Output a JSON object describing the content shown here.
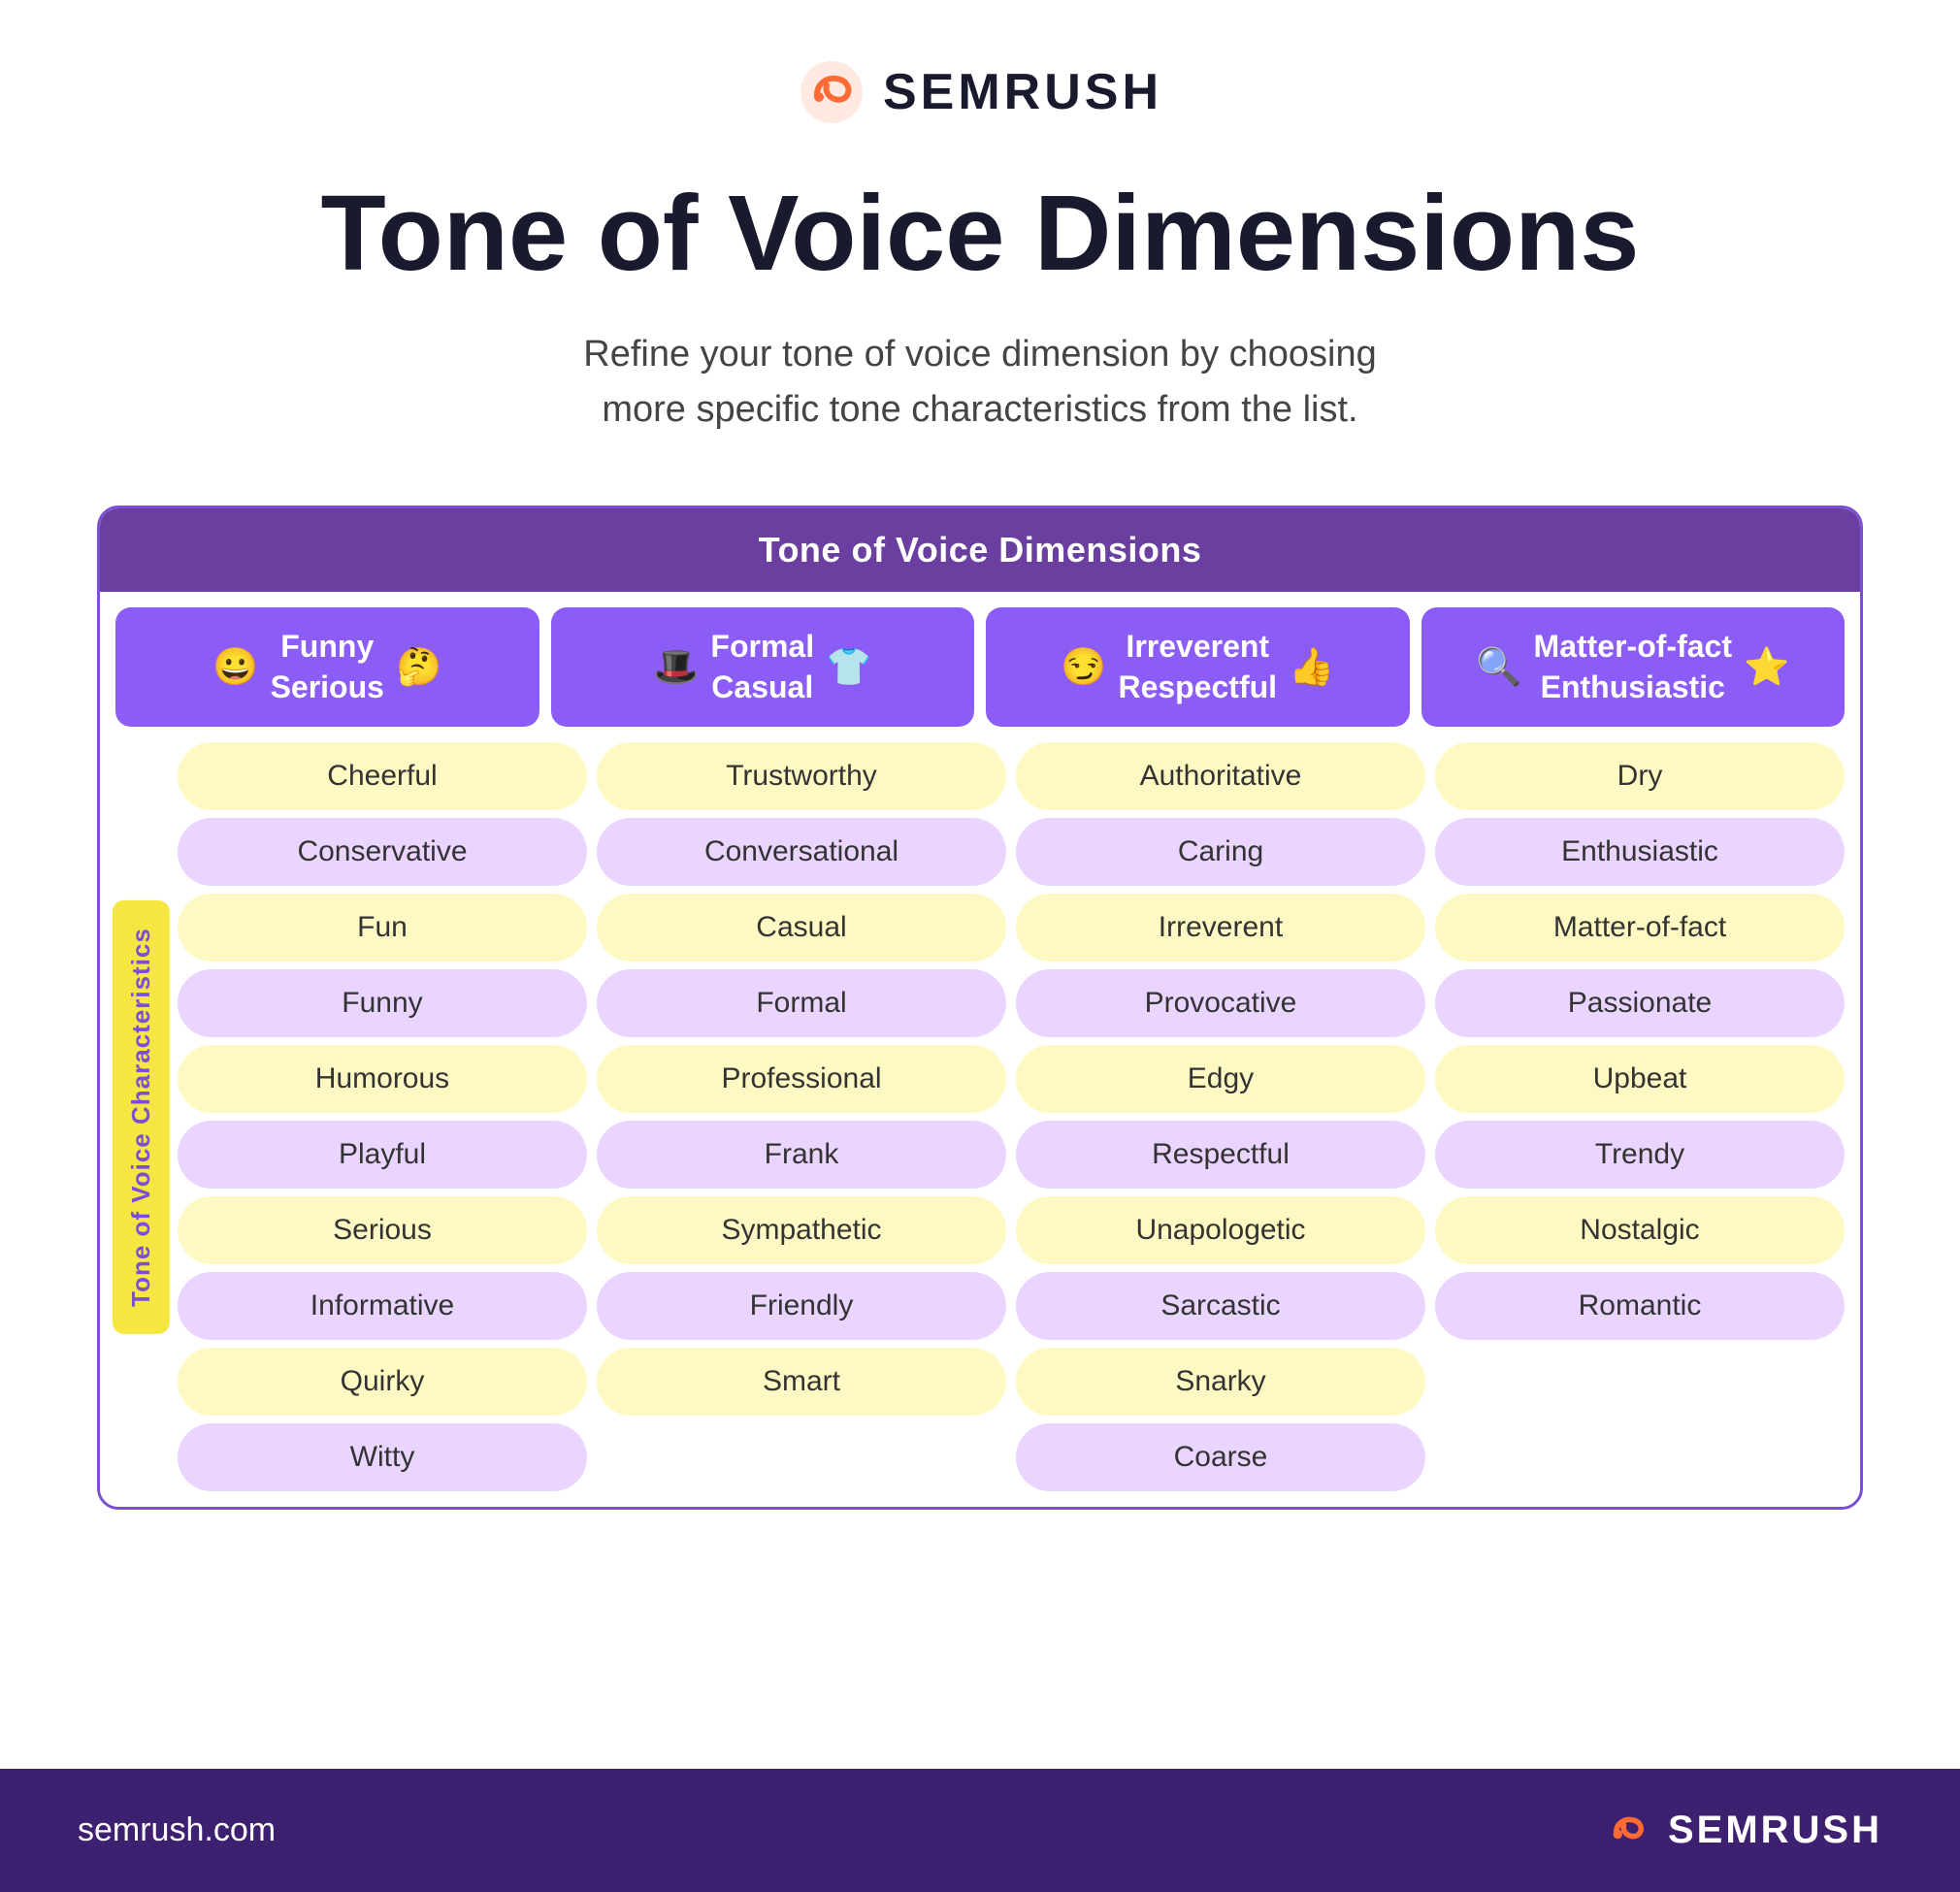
{
  "logo": {
    "text": "SEMRUSH"
  },
  "title": "Tone of Voice Dimensions",
  "subtitle": "Refine your tone of voice dimension by choosing more specific tone characteristics from the list.",
  "table": {
    "header": "Tone of Voice Dimensions",
    "columns": [
      {
        "label": "Funny\nSerious",
        "emoji_left": "😀",
        "emoji_right": "🤔"
      },
      {
        "label": "Formal\nCasual",
        "emoji_left": "🎩",
        "emoji_right": "👕"
      },
      {
        "label": "Irreverent\nRespectful",
        "emoji_left": "😏",
        "emoji_right": "👍"
      },
      {
        "label": "Matter-of-fact\nEnthusiastic",
        "emoji_left": "🔍",
        "emoji_right": "⭐"
      }
    ],
    "side_label": "Tone of Voice Characteristics",
    "rows": [
      [
        "Cheerful",
        "Trustworthy",
        "Authoritative",
        "Dry"
      ],
      [
        "Conservative",
        "Conversational",
        "Caring",
        "Enthusiastic"
      ],
      [
        "Fun",
        "Casual",
        "Irreverent",
        "Matter-of-fact"
      ],
      [
        "Funny",
        "Formal",
        "Provocative",
        "Passionate"
      ],
      [
        "Humorous",
        "Professional",
        "Edgy",
        "Upbeat"
      ],
      [
        "Playful",
        "Frank",
        "Respectful",
        "Trendy"
      ],
      [
        "Serious",
        "Sympathetic",
        "Unapologetic",
        "Nostalgic"
      ],
      [
        "Informative",
        "Friendly",
        "Sarcastic",
        "Romantic"
      ],
      [
        "Quirky",
        "Smart",
        "Snarky",
        ""
      ],
      [
        "Witty",
        "",
        "Coarse",
        ""
      ]
    ]
  },
  "footer": {
    "url": "semrush.com",
    "logo_text": "SEMRUSH"
  }
}
